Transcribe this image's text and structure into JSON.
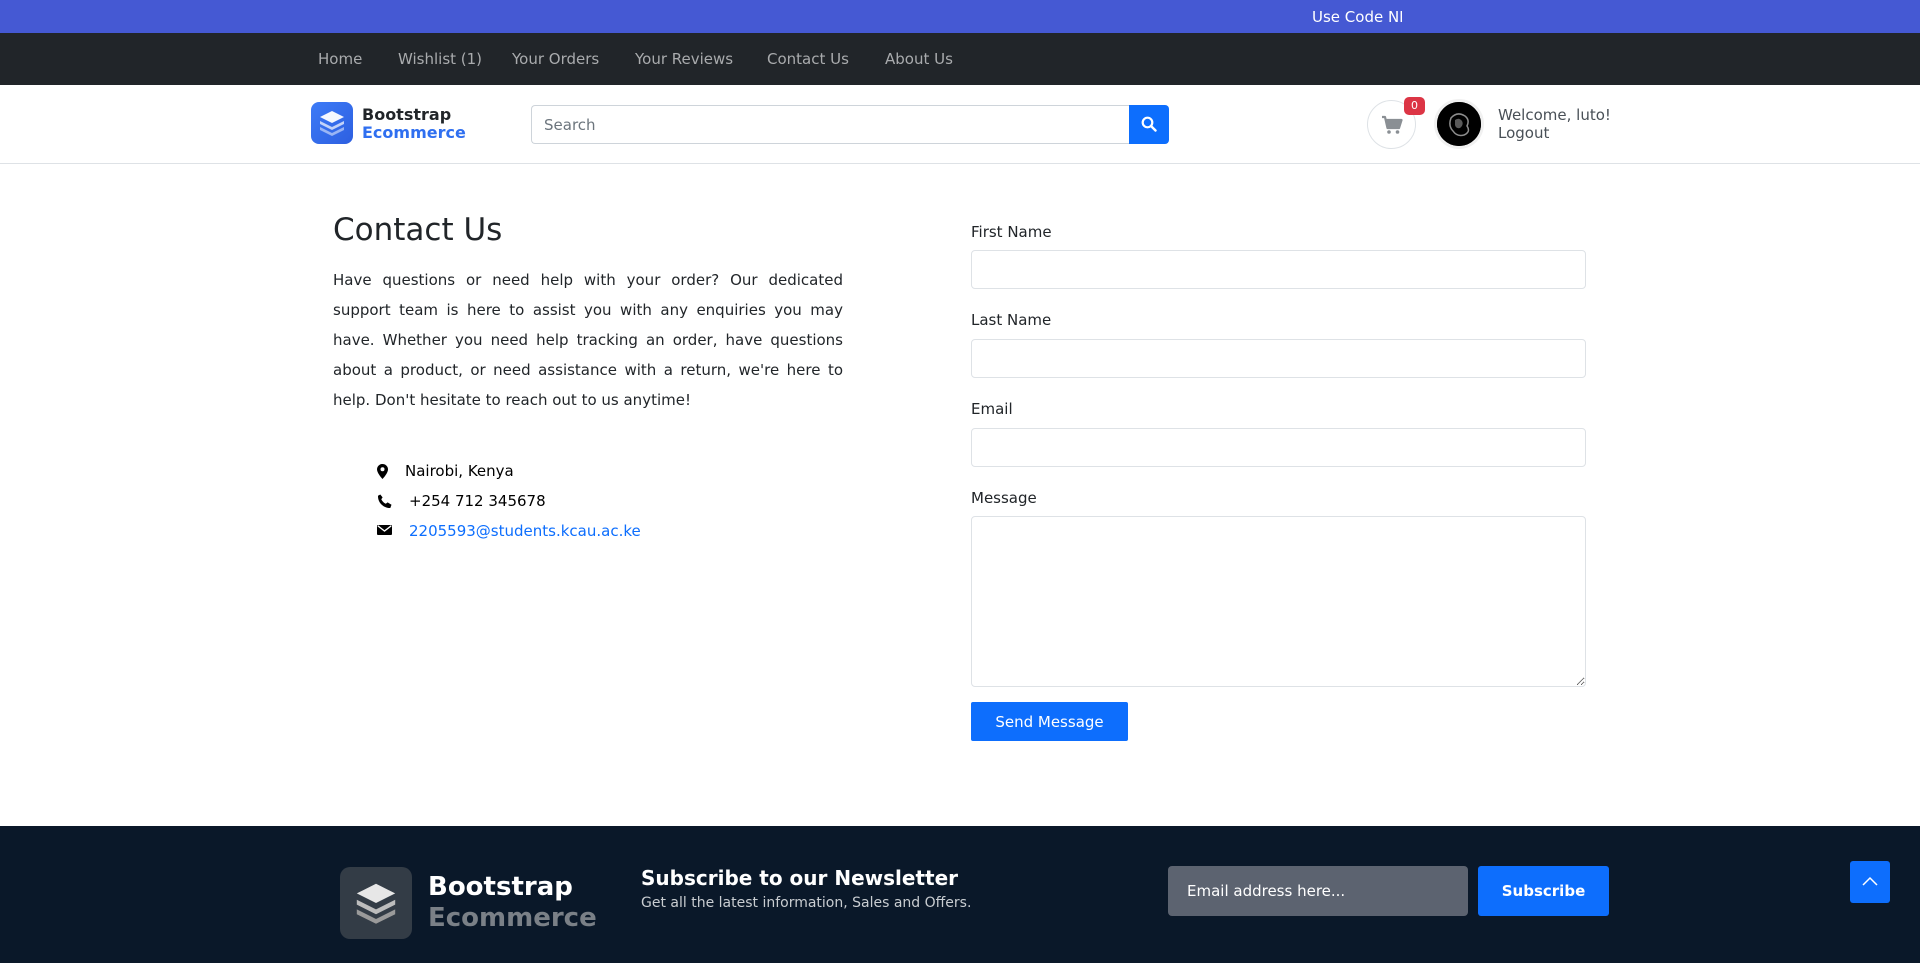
{
  "promo": {
    "text": "Use Code NI"
  },
  "nav": {
    "items": [
      {
        "label": "Home"
      },
      {
        "label": "Wishlist (1)"
      },
      {
        "label": "Your Orders"
      },
      {
        "label": "Your Reviews"
      },
      {
        "label": "Contact Us"
      },
      {
        "label": "About Us"
      }
    ]
  },
  "header": {
    "brand_line1": "Bootstrap",
    "brand_line2": "Ecommerce",
    "search_placeholder": "Search",
    "cart_count": "0",
    "welcome": "Welcome, luto!",
    "logout": "Logout"
  },
  "contact": {
    "title": "Contact Us",
    "description": "Have questions or need help with your order? Our dedicated support team is here to assist you with any enquiries you may have. Whether you need help tracking an order, have questions about a product, or need assistance with a return, we're here to help. Don't hesitate to reach out to us anytime!",
    "location": "Nairobi, Kenya",
    "phone": "+254 712 345678",
    "email": "2205593@students.kcau.ac.ke"
  },
  "form": {
    "first_name_label": "First Name",
    "last_name_label": "Last Name",
    "email_label": "Email",
    "message_label": "Message",
    "submit_label": "Send Message"
  },
  "footer": {
    "brand_line1": "Bootstrap",
    "brand_line2": "Ecommerce",
    "newsletter_title": "Subscribe to our Newsletter",
    "newsletter_subtitle": "Get all the latest information, Sales and Offers.",
    "email_placeholder": "Email address here...",
    "subscribe_label": "Subscribe"
  },
  "colors": {
    "promo_bg": "#4559d3",
    "nav_bg": "#212529",
    "primary": "#0d6efd",
    "footer_bg": "#0a1829",
    "badge": "#dc3545"
  },
  "icons": {
    "logo": "layers-icon",
    "search": "search-icon",
    "cart": "cart-icon",
    "location": "map-marker-icon",
    "phone": "phone-icon",
    "email": "envelope-icon",
    "back_to_top": "chevron-up-icon"
  }
}
